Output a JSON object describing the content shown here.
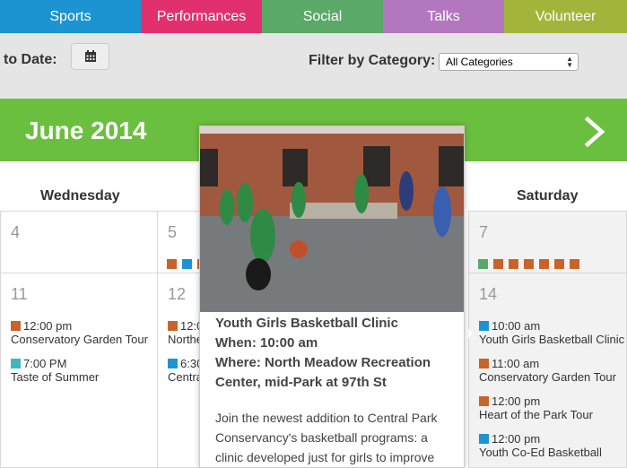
{
  "tabs": [
    {
      "label": "Sports",
      "color": "#1c94d2"
    },
    {
      "label": "Performances",
      "color": "#e2306f"
    },
    {
      "label": "Social",
      "color": "#5aa968"
    },
    {
      "label": "Talks",
      "color": "#b277be"
    },
    {
      "label": "Volunteer",
      "color": "#a4b43a"
    }
  ],
  "filters": {
    "to_date_label": "to Date:",
    "calendar_icon": "calendar-icon",
    "category_label": "Filter by Category:",
    "category_value": "All Categories"
  },
  "month": {
    "title": "June 2014",
    "next_icon": "chevron-right-icon",
    "bar_color": "#6bbf3e"
  },
  "day_headers": {
    "wednesday": "Wednesday",
    "saturday": "Saturday"
  },
  "week1": {
    "wed": {
      "day": "4"
    },
    "thu": {
      "day": "5"
    },
    "sat": {
      "day": "7"
    }
  },
  "week2": {
    "wed": {
      "day": "11",
      "events": [
        {
          "time": "12:00 pm",
          "title": "Conservatory Garden Tour",
          "color": "#c8642a"
        },
        {
          "time": "7:00 PM",
          "title": "Taste of Summer",
          "color": "#3fb8b8"
        }
      ]
    },
    "thu": {
      "day": "12",
      "events": [
        {
          "time": "12:0",
          "title": "Northe",
          "color": "#c8642a"
        },
        {
          "time": "6:30",
          "title": "Centra",
          "color": "#1c94d2"
        }
      ]
    },
    "sat": {
      "day": "14",
      "events": [
        {
          "time": "10:00 am",
          "title": "Youth Girls Basketball Clinic",
          "color": "#1c94d2"
        },
        {
          "time": "11:00 am",
          "title": "Conservatory Garden Tour",
          "color": "#c8642a"
        },
        {
          "time": "12:00 pm",
          "title": "Heart of the Park Tour",
          "color": "#c8642a"
        },
        {
          "time": "12:00 pm",
          "title": "Youth Co-Ed Basketball",
          "color": "#1c94d2"
        }
      ]
    }
  },
  "popup": {
    "title": "Youth Girls Basketball Clinic",
    "when": "When: 10:00 am",
    "where": "Where: North Meadow Recreation Center, mid-Park at 97th St",
    "description": "Join the newest addition to Central Park Conservancy's basketball programs: a clinic developed just for girls to improve"
  }
}
